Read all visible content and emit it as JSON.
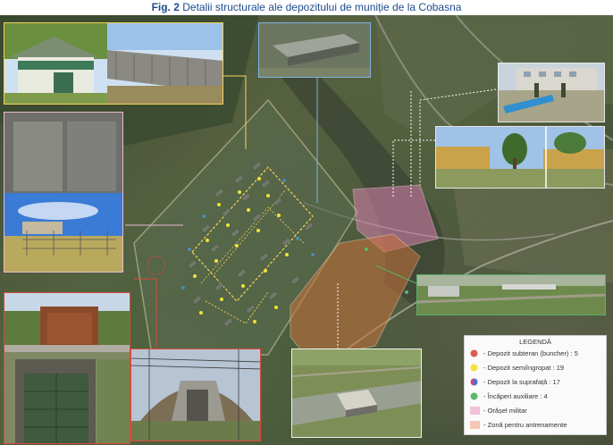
{
  "figure": {
    "number": "Fig. 2",
    "title": "Detalii structurale ale depozitului de muniție de la Cobasna"
  },
  "legend": {
    "title": "LEGENDĂ",
    "items": [
      {
        "label": "- Depozit subteran (buncher) : 5",
        "color": "#e05a4f"
      },
      {
        "label": "- Depozit semiîngropat : 19",
        "color": "#f2e33a"
      },
      {
        "label": "- Depozit la suprafață : 17",
        "color": "#7a6bc9"
      },
      {
        "label": "- Încăperi auxiliare : 4",
        "color": "#5cb86a"
      },
      {
        "label": "- Orășel militar",
        "color": "#efc3d8"
      },
      {
        "label": "- Zonă pentru antrenamente",
        "color": "#f4c7b3"
      }
    ]
  },
  "colors": {
    "title": "#1e4c8e",
    "subteran_outline": "#d94a3a",
    "semiingropat_outline": "#e6d23a",
    "suprafata_outline": "#4c8fd1",
    "auxiliare_outline": "#59b06a",
    "military_town_outline": "#e6e6e6",
    "training_zone_outline": "#e6c3a3",
    "base_outline": "#f3d35a"
  }
}
